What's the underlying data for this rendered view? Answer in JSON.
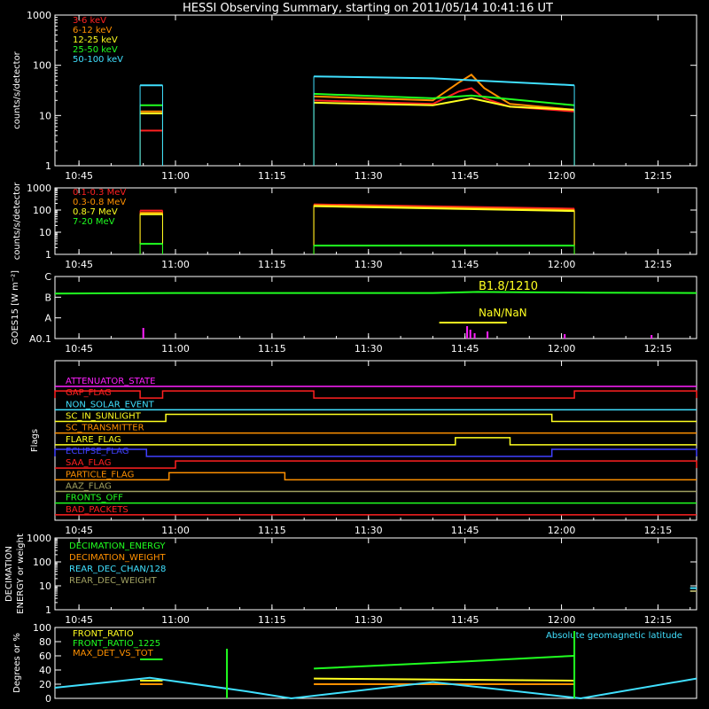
{
  "page": {
    "title": "HESSI Observing Summary, starting on 2011/05/14 10:41:16 UT",
    "time_ticks": [
      "10:45",
      "11:00",
      "11:15",
      "11:30",
      "11:45",
      "12:00",
      "12:15"
    ]
  },
  "chart_data": [
    {
      "type": "line",
      "title": "",
      "ylabel": "counts/s/detector",
      "y_scale": "log",
      "ylim": [
        1,
        1000
      ],
      "ytick_labels": [
        "1",
        "10",
        "100",
        "1000"
      ],
      "xlim": [
        "10:41:16",
        "12:21:00"
      ],
      "x_unit": "time (UT)",
      "x_ticks": [
        "10:45",
        "11:00",
        "11:15",
        "11:30",
        "11:45",
        "12:00",
        "12:15"
      ],
      "series": [
        {
          "name": "3-6 keV",
          "color": "#ff2020",
          "segments": [
            {
              "x": [
                "10:54:30",
                "10:58:00"
              ],
              "y": [
                5,
                5
              ]
            },
            {
              "x": [
                "11:21:30",
                "11:40:00",
                "11:44:00",
                "11:46:00",
                "11:48:00",
                "11:52:00",
                "12:02:00"
              ],
              "y": [
                20,
                17,
                30,
                35,
                22,
                15,
                12
              ]
            }
          ]
        },
        {
          "name": "6-12 keV",
          "color": "#ff9000",
          "segments": [
            {
              "x": [
                "10:54:30",
                "10:58:00"
              ],
              "y": [
                12,
                12
              ]
            },
            {
              "x": [
                "11:21:30",
                "11:40:00",
                "11:44:00",
                "11:46:00",
                "11:48:00",
                "11:52:00",
                "12:02:00"
              ],
              "y": [
                24,
                20,
                45,
                65,
                35,
                17,
                13
              ]
            }
          ]
        },
        {
          "name": "12-25 keV",
          "color": "#ffff20",
          "segments": [
            {
              "x": [
                "10:54:30",
                "10:58:00"
              ],
              "y": [
                11,
                11
              ]
            },
            {
              "x": [
                "11:21:30",
                "11:40:00",
                "11:46:00",
                "11:52:00",
                "12:02:00"
              ],
              "y": [
                18,
                16,
                22,
                15,
                13
              ]
            }
          ]
        },
        {
          "name": "25-50 keV",
          "color": "#20ff20",
          "segments": [
            {
              "x": [
                "10:54:30",
                "10:58:00"
              ],
              "y": [
                16,
                16
              ]
            },
            {
              "x": [
                "11:21:30",
                "11:40:00",
                "11:46:00",
                "12:02:00"
              ],
              "y": [
                27,
                22,
                25,
                16
              ]
            }
          ]
        },
        {
          "name": "50-100 keV",
          "color": "#40e0ff",
          "segments": [
            {
              "x": [
                "10:54:30",
                "10:58:00"
              ],
              "y": [
                40,
                40
              ]
            },
            {
              "x": [
                "11:21:30",
                "11:40:00",
                "12:02:00"
              ],
              "y": [
                60,
                55,
                40
              ]
            }
          ]
        }
      ]
    },
    {
      "type": "line",
      "title": "",
      "ylabel": "counts/s/detector",
      "y_scale": "log",
      "ylim": [
        1,
        1000
      ],
      "ytick_labels": [
        "1",
        "10",
        "100",
        "1000"
      ],
      "xlim": [
        "10:41:16",
        "12:21:00"
      ],
      "x_unit": "time (UT)",
      "x_ticks": [
        "10:45",
        "11:00",
        "11:15",
        "11:30",
        "11:45",
        "12:00",
        "12:15"
      ],
      "series": [
        {
          "name": "0.1-0.3 MeV",
          "color": "#ff2020",
          "segments": [
            {
              "x": [
                "10:54:30",
                "10:58:00"
              ],
              "y": [
                95,
                95
              ]
            },
            {
              "x": [
                "11:21:30",
                "12:02:00"
              ],
              "y": [
                180,
                115
              ]
            }
          ]
        },
        {
          "name": "0.3-0.8 MeV",
          "color": "#ff9000",
          "segments": [
            {
              "x": [
                "10:54:30",
                "10:58:00"
              ],
              "y": [
                75,
                75
              ]
            },
            {
              "x": [
                "11:21:30",
                "12:02:00"
              ],
              "y": [
                165,
                100
              ]
            }
          ]
        },
        {
          "name": "0.8-7 MeV",
          "color": "#ffff20",
          "segments": [
            {
              "x": [
                "10:54:30",
                "10:58:00"
              ],
              "y": [
                65,
                65
              ]
            },
            {
              "x": [
                "11:21:30",
                "12:02:00"
              ],
              "y": [
                150,
                90
              ]
            }
          ]
        },
        {
          "name": "7-20 MeV",
          "color": "#20ff20",
          "segments": [
            {
              "x": [
                "10:54:30",
                "10:58:00"
              ],
              "y": [
                3,
                3
              ]
            },
            {
              "x": [
                "11:21:30",
                "12:02:00"
              ],
              "y": [
                2.5,
                2.5
              ]
            }
          ]
        }
      ]
    },
    {
      "type": "line",
      "title": "",
      "ylabel": "GOES15 [W m⁻²]",
      "y_scale": "log",
      "ytick_labels": [
        "A0.1",
        "A",
        "B",
        "C"
      ],
      "xlim": [
        "10:41:16",
        "12:21:00"
      ],
      "x_unit": "time (UT)",
      "annotations": [
        "B1.8/1210",
        "NaN/NaN"
      ],
      "series": [
        {
          "color": "#20ff20",
          "segments": [
            {
              "x": [
                "10:41:16",
                "11:00:00",
                "11:40:00",
                "11:47:00",
                "11:54:00",
                "12:05:00",
                "12:21:00"
              ],
              "y": [
                1.5e-07,
                1.6e-07,
                1.6e-07,
                1.8e-07,
                1.75e-07,
                1.65e-07,
                1.6e-07
              ]
            }
          ]
        }
      ]
    },
    {
      "type": "table",
      "ylabel": "Flags",
      "xlim": [
        "10:41:16",
        "12:21:00"
      ],
      "x_unit": "time (UT)",
      "x_ticks": [
        "10:45",
        "11:00",
        "11:15",
        "11:30",
        "11:45",
        "12:00",
        "12:15"
      ],
      "rows": [
        {
          "name": "ATTENUATOR_STATE",
          "color": "#ff20ff",
          "on": []
        },
        {
          "name": "GAP_FLAG",
          "color": "#ff2020",
          "on": [
            [
              "10:41:16",
              "10:54:30"
            ],
            [
              "10:58:00",
              "11:21:30"
            ],
            [
              "12:02:00",
              "12:21:00"
            ]
          ]
        },
        {
          "name": "NON_SOLAR_EVENT",
          "color": "#40e0ff",
          "on": []
        },
        {
          "name": "SC_IN_SUNLIGHT",
          "color": "#ffff20",
          "on": [
            [
              "10:58:30",
              "11:58:30"
            ]
          ]
        },
        {
          "name": "SC_TRANSMITTER",
          "color": "#ff9000",
          "on": []
        },
        {
          "name": "FLARE_FLAG",
          "color": "#ffff20",
          "on": [
            [
              "11:43:30",
              "11:52:00"
            ]
          ]
        },
        {
          "name": "ECLIPSE_FLAG",
          "color": "#4040ff",
          "on": [
            [
              "10:41:16",
              "10:55:30"
            ],
            [
              "11:58:30",
              "12:21:00"
            ]
          ]
        },
        {
          "name": "SAA_FLAG",
          "color": "#ff2020",
          "on": [
            [
              "11:00:00",
              "12:21:00"
            ]
          ]
        },
        {
          "name": "PARTICLE_FLAG",
          "color": "#ff9000",
          "on": [
            [
              "10:59:00",
              "11:17:00"
            ]
          ]
        },
        {
          "name": "AAZ_FLAG",
          "color": "#a0a060",
          "on": []
        },
        {
          "name": "FRONTS_OFF",
          "color": "#20ff20",
          "on": []
        },
        {
          "name": "BAD_PACKETS",
          "color": "#ff2020",
          "on": []
        }
      ]
    },
    {
      "type": "line",
      "ylabel": "DECIMATION ENERGY or weight",
      "y_scale": "log",
      "ylim": [
        1,
        1000
      ],
      "ytick_labels": [
        "1",
        "10",
        "100",
        "1000"
      ],
      "xlim": [
        "10:41:16",
        "12:21:00"
      ],
      "x_unit": "time (UT)",
      "x_ticks": [
        "10:45",
        "11:00",
        "11:15",
        "11:30",
        "11:45",
        "12:00",
        "12:15"
      ],
      "series": [
        {
          "name": "DECIMATION_ENERGY",
          "color": "#20ff20",
          "segments": []
        },
        {
          "name": "DECIMATION_WEIGHT",
          "color": "#ff9000",
          "segments": []
        },
        {
          "name": "REAR_DEC_CHAN/128",
          "color": "#40e0ff",
          "segments": [
            {
              "x": [
                "12:20:00",
                "12:21:00"
              ],
              "y": [
                8,
                8
              ]
            }
          ]
        },
        {
          "name": "REAR_DEC_WEIGHT",
          "color": "#a0a060",
          "segments": [
            {
              "x": [
                "12:20:00",
                "12:21:00"
              ],
              "y": [
                6,
                6
              ]
            }
          ]
        }
      ]
    },
    {
      "type": "line",
      "ylabel": "Degrees or %",
      "ylim": [
        0,
        100
      ],
      "ytick_labels": [
        "0",
        "20",
        "40",
        "60",
        "80",
        "100"
      ],
      "xlim": [
        "10:41:16",
        "12:21:00"
      ],
      "x_unit": "time (UT)",
      "annotations": [
        "Absolute geomagnetic latitude"
      ],
      "series": [
        {
          "name": "FRONT_RATIO",
          "color": "#ffff20",
          "segments": [
            {
              "x": [
                "10:54:30",
                "10:58:00"
              ],
              "y": [
                25,
                25
              ]
            },
            {
              "x": [
                "11:21:30",
                "12:02:00"
              ],
              "y": [
                28,
                25
              ]
            }
          ]
        },
        {
          "name": "FRONT_RATIO_1225",
          "color": "#20ff20",
          "segments": [
            {
              "x": [
                "10:54:30",
                "10:58:00"
              ],
              "y": [
                55,
                55
              ]
            },
            {
              "x": [
                "11:21:30",
                "11:45:00",
                "12:02:00"
              ],
              "y": [
                42,
                52,
                60
              ]
            }
          ]
        },
        {
          "name": "MAX_DET_VS_TOT",
          "color": "#ff9000",
          "segments": [
            {
              "x": [
                "10:54:30",
                "10:58:00"
              ],
              "y": [
                20,
                20
              ]
            },
            {
              "x": [
                "11:21:30",
                "12:02:00"
              ],
              "y": [
                20,
                20
              ]
            }
          ]
        },
        {
          "name": "Absolute geomagnetic latitude",
          "color": "#40e0ff",
          "segments": [
            {
              "x": [
                "10:41:16",
                "10:56:00",
                "11:11:00",
                "11:18:00",
                "11:40:00",
                "12:03:00",
                "12:21:00"
              ],
              "y": [
                15,
                29,
                10,
                0,
                23,
                0,
                28
              ]
            }
          ]
        }
      ]
    }
  ]
}
